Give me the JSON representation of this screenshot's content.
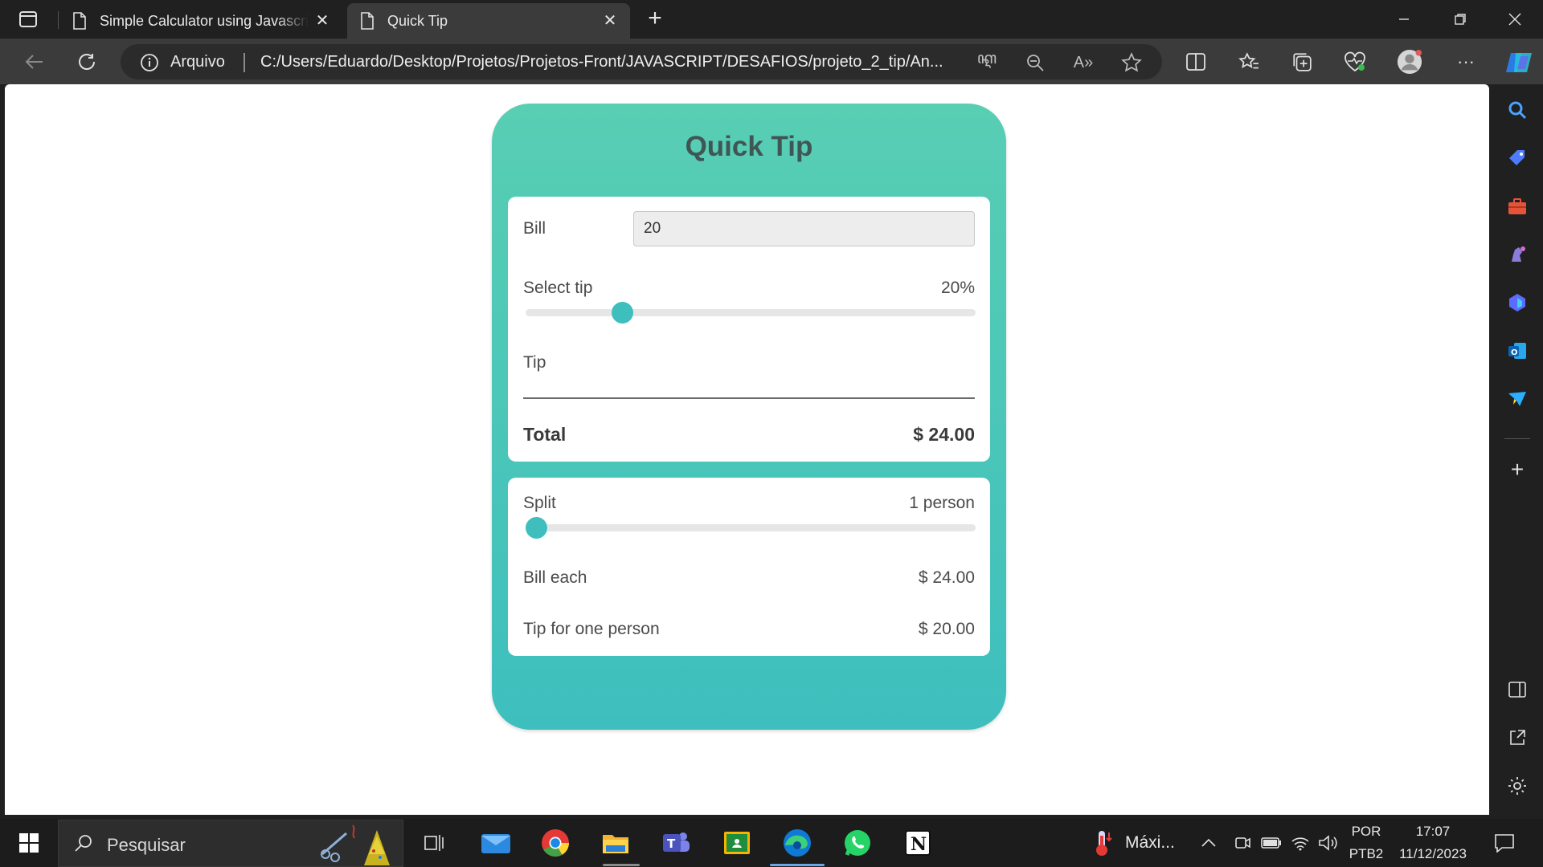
{
  "browser": {
    "tabs": [
      {
        "title": "Simple Calculator using Javascrip",
        "active": false
      },
      {
        "title": "Quick Tip",
        "active": true
      }
    ],
    "address": {
      "protocol_label": "Arquivo",
      "url": "C:/Users/Eduardo/Desktop/Projetos/Projetos-Front/JAVASCRIPT/DESAFIOS/projeto_2_tip/An..."
    }
  },
  "app": {
    "title": "Quick Tip",
    "bill": {
      "label": "Bill",
      "value": "20"
    },
    "tip_select": {
      "label": "Select tip",
      "value": "20%",
      "slider_fraction": 0.2
    },
    "tip": {
      "label": "Tip",
      "value": ""
    },
    "total": {
      "label": "Total",
      "value": "$ 24.00"
    },
    "split": {
      "label": "Split",
      "value": "1 person",
      "slider_fraction": 0.0
    },
    "bill_each": {
      "label": "Bill each",
      "value": "$ 24.00"
    },
    "tip_each": {
      "label": "Tip for one person",
      "value": "$ 20.00"
    }
  },
  "taskbar": {
    "search_placeholder": "Pesquisar",
    "weather_text": "Máxi...",
    "lang_line1": "POR",
    "lang_line2": "PTB2",
    "time": "17:07",
    "date": "11/12/2023"
  },
  "colors": {
    "accent_teal": "#3ebfbe",
    "card_top": "#58ceb3",
    "title_text": "#3f5654"
  }
}
